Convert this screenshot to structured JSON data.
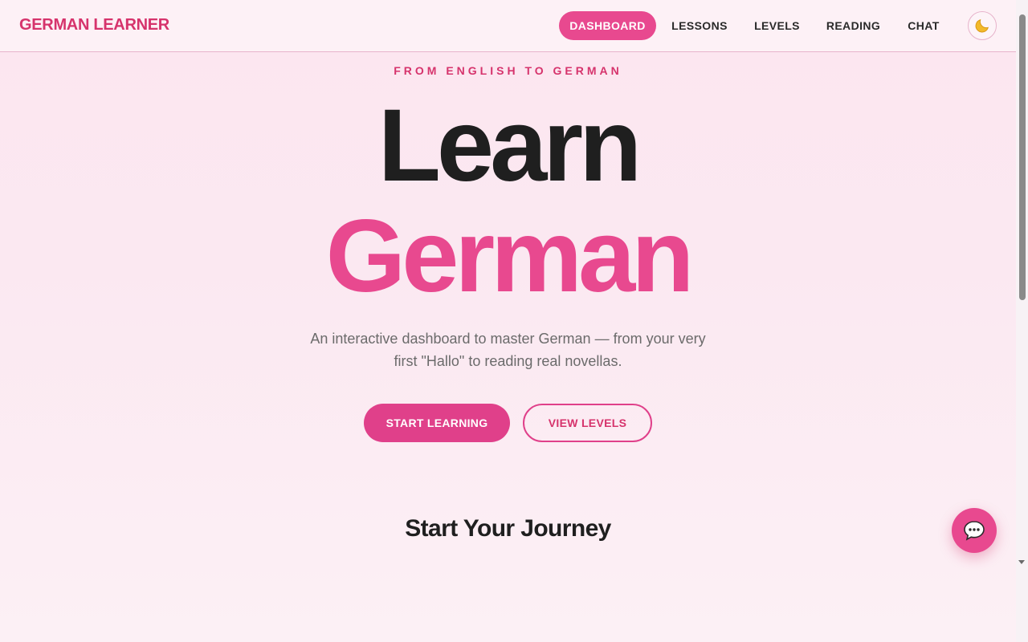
{
  "header": {
    "brand": "GERMAN LEARNER",
    "nav": [
      {
        "label": "DASHBOARD",
        "active": true
      },
      {
        "label": "LESSONS",
        "active": false
      },
      {
        "label": "LEVELS",
        "active": false
      },
      {
        "label": "READING",
        "active": false
      },
      {
        "label": "CHAT",
        "active": false
      }
    ],
    "theme_toggle_icon": "moon-icon"
  },
  "hero": {
    "eyebrow": "FROM ENGLISH TO GERMAN",
    "title_line1": "Learn",
    "title_line2": "German",
    "subtitle": "An interactive dashboard to master German — from your very first \"Hallo\" to reading real novellas.",
    "primary_button": "START LEARNING",
    "secondary_button": "VIEW LEVELS"
  },
  "journey": {
    "title": "Start Your Journey"
  },
  "chat_fab_icon": "chat-bubble-icon",
  "colors": {
    "accent": "#e8498f",
    "accent_dark": "#d6336c",
    "text": "#1f1f1f",
    "muted": "#6b6b6b",
    "background": "#fce6f0"
  }
}
